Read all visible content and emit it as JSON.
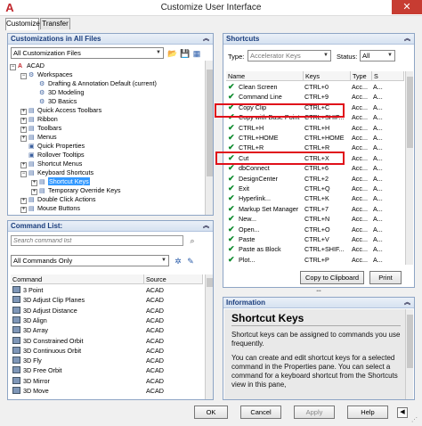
{
  "window": {
    "title": "Customize User Interface",
    "close": "✕",
    "app_icon": "autocad-logo-icon"
  },
  "tabs": [
    "Customize",
    "Transfer"
  ],
  "customizations": {
    "title": "Customizations in All Files",
    "file_combo": "All Customization Files",
    "tree": [
      {
        "label": "ACAD",
        "indent": 0,
        "exp": "−",
        "icon": "A"
      },
      {
        "label": "Workspaces",
        "indent": 1,
        "exp": "−",
        "icon": "⚙"
      },
      {
        "label": "Drafting & Annotation Default (current)",
        "indent": 2,
        "exp": "",
        "icon": "⚙"
      },
      {
        "label": "3D Modeling",
        "indent": 2,
        "exp": "",
        "icon": "⚙"
      },
      {
        "label": "3D Basics",
        "indent": 2,
        "exp": "",
        "icon": "⚙"
      },
      {
        "label": "Quick Access Toolbars",
        "indent": 1,
        "exp": "+",
        "icon": "▤"
      },
      {
        "label": "Ribbon",
        "indent": 1,
        "exp": "+",
        "icon": "▤"
      },
      {
        "label": "Toolbars",
        "indent": 1,
        "exp": "+",
        "icon": "▤"
      },
      {
        "label": "Menus",
        "indent": 1,
        "exp": "+",
        "icon": "▤"
      },
      {
        "label": "Quick Properties",
        "indent": 1,
        "exp": "",
        "icon": "▣"
      },
      {
        "label": "Rollover Tooltips",
        "indent": 1,
        "exp": "",
        "icon": "▣"
      },
      {
        "label": "Shortcut Menus",
        "indent": 1,
        "exp": "+",
        "icon": "▤"
      },
      {
        "label": "Keyboard Shortcuts",
        "indent": 1,
        "exp": "−",
        "icon": "▤"
      },
      {
        "label": "Shortcut Keys",
        "indent": 2,
        "exp": "+",
        "icon": "▤",
        "selected": true
      },
      {
        "label": "Temporary Override Keys",
        "indent": 2,
        "exp": "+",
        "icon": "▤"
      },
      {
        "label": "Double Click Actions",
        "indent": 1,
        "exp": "+",
        "icon": "▤"
      },
      {
        "label": "Mouse Buttons",
        "indent": 1,
        "exp": "+",
        "icon": "▤"
      }
    ]
  },
  "command_list": {
    "title": "Command List:",
    "search_placeholder": "Search command list",
    "filter_combo": "All Commands Only",
    "columns": [
      "Command",
      "Source"
    ],
    "rows": [
      {
        "name": "3 Point",
        "source": "ACAD"
      },
      {
        "name": "3D Adjust Clip Planes",
        "source": "ACAD"
      },
      {
        "name": "3D Adjust Distance",
        "source": "ACAD"
      },
      {
        "name": "3D Align",
        "source": "ACAD"
      },
      {
        "name": "3D Array",
        "source": "ACAD"
      },
      {
        "name": "3D Constrained Orbit",
        "source": "ACAD"
      },
      {
        "name": "3D Continuous Orbit",
        "source": "ACAD"
      },
      {
        "name": "3D Fly",
        "source": "ACAD"
      },
      {
        "name": "3D Free Orbit",
        "source": "ACAD"
      },
      {
        "name": "3D Mirror",
        "source": "ACAD"
      },
      {
        "name": "3D Move",
        "source": "ACAD"
      }
    ]
  },
  "shortcuts": {
    "title": "Shortcuts",
    "type_label": "Type:",
    "type_value": "Accelerator Keys",
    "status_label": "Status:",
    "status_value": "All",
    "columns": [
      "Name",
      "Keys",
      "Type",
      "S"
    ],
    "rows": [
      {
        "name": "Clean Screen",
        "keys": "CTRL+0",
        "type": "Acc...",
        "s": "A..."
      },
      {
        "name": "Command Line",
        "keys": "CTRL+9",
        "type": "Acc...",
        "s": "A..."
      },
      {
        "name": "Copy Clip",
        "keys": "CTRL+C",
        "type": "Acc...",
        "s": "A..."
      },
      {
        "name": "Copy with Base Point",
        "keys": "CTRL+SHIF...",
        "type": "Acc...",
        "s": "A..."
      },
      {
        "name": "CTRL+H",
        "keys": "CTRL+H",
        "type": "Acc...",
        "s": "A..."
      },
      {
        "name": "CTRL+HOME",
        "keys": "CTRL+HOME",
        "type": "Acc...",
        "s": "A..."
      },
      {
        "name": "CTRL+R",
        "keys": "CTRL+R",
        "type": "Acc...",
        "s": "A..."
      },
      {
        "name": "Cut",
        "keys": "CTRL+X",
        "type": "Acc...",
        "s": "A..."
      },
      {
        "name": "dbConnect",
        "keys": "CTRL+6",
        "type": "Acc...",
        "s": "A..."
      },
      {
        "name": "DesignCenter",
        "keys": "CTRL+2",
        "type": "Acc...",
        "s": "A..."
      },
      {
        "name": "Exit",
        "keys": "CTRL+Q",
        "type": "Acc...",
        "s": "A..."
      },
      {
        "name": "Hyperlink...",
        "keys": "CTRL+K",
        "type": "Acc...",
        "s": "A..."
      },
      {
        "name": "Markup Set Manager",
        "keys": "CTRL+7",
        "type": "Acc...",
        "s": "A..."
      },
      {
        "name": "New...",
        "keys": "CTRL+N",
        "type": "Acc...",
        "s": "A..."
      },
      {
        "name": "Open...",
        "keys": "CTRL+O",
        "type": "Acc...",
        "s": "A..."
      },
      {
        "name": "Paste",
        "keys": "CTRL+V",
        "type": "Acc...",
        "s": "A..."
      },
      {
        "name": "Paste as Block",
        "keys": "CTRL+SHIF...",
        "type": "Acc...",
        "s": "A..."
      },
      {
        "name": "Plot...",
        "keys": "CTRL+P",
        "type": "Acc...",
        "s": "A..."
      }
    ],
    "copy_button": "Copy to Clipboard",
    "print_button": "Print"
  },
  "information": {
    "title": "Information",
    "heading": "Shortcut Keys",
    "paragraphs": [
      "Shortcut keys can be assigned to commands you use frequently.",
      "You can create and edit shortcut keys for a selected command in the Properties pane. You can select a command for a keyboard shortcut from the Shortcuts view in this pane,"
    ]
  },
  "footer": {
    "ok": "OK",
    "cancel": "Cancel",
    "apply": "Apply",
    "help": "Help"
  }
}
